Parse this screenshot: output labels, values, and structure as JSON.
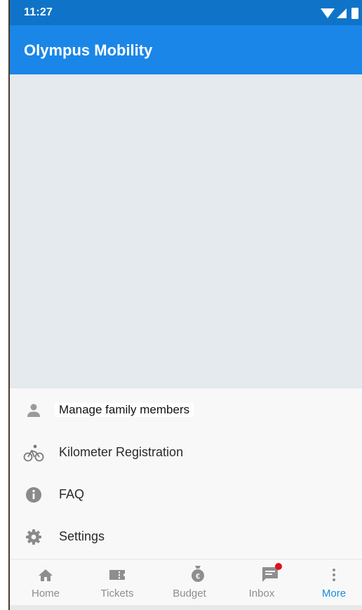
{
  "status_bar": {
    "time": "11:27",
    "icons": [
      "wifi-icon",
      "signal-icon",
      "battery-icon"
    ]
  },
  "app_bar": {
    "title": "Olympus Mobility"
  },
  "menu": {
    "items": [
      {
        "label": "Manage family members",
        "icon": "person-icon"
      },
      {
        "label": "Kilometer Registration",
        "icon": "bicycle-icon"
      },
      {
        "label": "FAQ",
        "icon": "info-icon"
      },
      {
        "label": "Settings",
        "icon": "gear-icon"
      }
    ]
  },
  "bottom_nav": {
    "items": [
      {
        "label": "Home",
        "icon": "home-icon"
      },
      {
        "label": "Tickets",
        "icon": "ticket-icon"
      },
      {
        "label": "Budget",
        "icon": "money-bag-icon"
      },
      {
        "label": "Inbox",
        "icon": "chat-icon"
      },
      {
        "label": "More",
        "icon": "more-vertical-icon"
      }
    ],
    "active": "More",
    "inbox_has_notification": true
  },
  "colors": {
    "status_bar": "#0f74c8",
    "app_bar": "#1a86e8",
    "content_background": "#e4eaed",
    "active_tab": "#1a8ae0",
    "inactive_tab": "#8e8e8e",
    "notification_dot": "#e0101c"
  }
}
